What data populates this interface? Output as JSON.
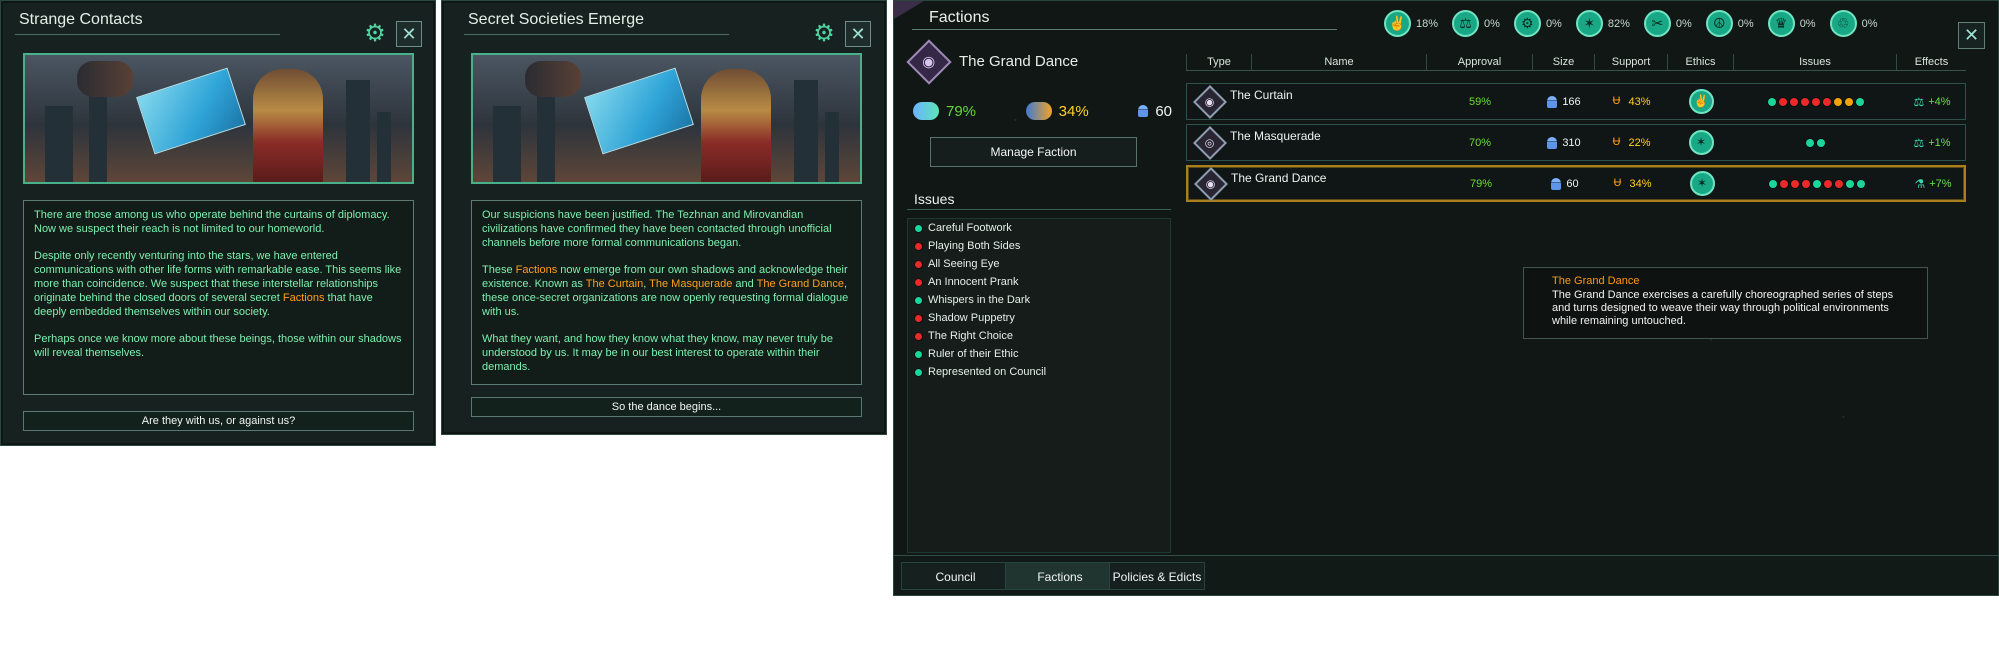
{
  "panels": {
    "strange": {
      "title": "Strange Contacts",
      "paragraphs": [
        "There are those among us who operate behind the curtains of diplomacy. Now we suspect their reach is not limited to our homeworld.",
        "Despite only recently venturing into the stars, we have entered communications with other life forms with remarkable ease. This seems like more than coincidence. We suspect that these interstellar relationships originate behind the closed doors of several secret ",
        "Factions",
        " that have deeply embedded themselves within our society.",
        "Perhaps once we know more about these beings, those within our shadows will reveal themselves."
      ],
      "button": "Are they with us, or against us?"
    },
    "secret": {
      "title": "Secret Societies Emerge",
      "paragraphs": [
        "Our suspicions have been justified. The Tezhnan and Mirovandian civilizations have confirmed they have been contacted through unofficial channels before more formal communications began.",
        "These ",
        "Factions",
        " now emerge from our own shadows and acknowledge their existence. Known as ",
        "The Curtain",
        ", ",
        "The Masquerade",
        " and ",
        "The Grand Dance",
        ", these once-secret organizations are now openly requesting formal dialogue with us.",
        "What they want, and how they know what they know, may never truly be understood by us. It may be in our best interest to operate within their demands."
      ],
      "button": "So the dance begins..."
    }
  },
  "factions": {
    "title": "Factions",
    "summary": {
      "faction_name": "The Grand Dance",
      "approval": "79%",
      "support": "34%",
      "size": "60",
      "manage_button": "Manage Faction"
    },
    "ethic_percentages": [
      "18%",
      "0%",
      "0%",
      "82%",
      "0%",
      "0%",
      "0%",
      "0%"
    ],
    "headers": [
      "Type",
      "Name",
      "Approval",
      "Size",
      "Support",
      "Ethics",
      "Issues",
      "Effects"
    ],
    "rows": [
      {
        "name": "The Curtain",
        "approval": "59%",
        "size": "166",
        "support": "43%",
        "effect": "+4%"
      },
      {
        "name": "The Masquerade",
        "approval": "70%",
        "size": "310",
        "support": "22%",
        "effect": "+1%"
      },
      {
        "name": "The Grand Dance",
        "approval": "79%",
        "size": "60",
        "support": "34%",
        "effect": "+7%"
      }
    ],
    "issues_title": "Issues",
    "issues": [
      "Careful Footwork",
      "Playing Both Sides",
      "All Seeing Eye",
      "An Innocent Prank",
      "Whispers in the Dark",
      "Shadow Puppetry",
      "The Right Choice",
      "Ruler of their Ethic",
      "Represented on Council"
    ],
    "tooltip": {
      "title": "The Grand Dance",
      "text": "The Grand Dance exercises a carefully choreographed series of steps and turns designed to weave their way through political environments while remaining untouched."
    },
    "tabs": [
      "Council",
      "Factions",
      "Policies & Edicts"
    ]
  }
}
